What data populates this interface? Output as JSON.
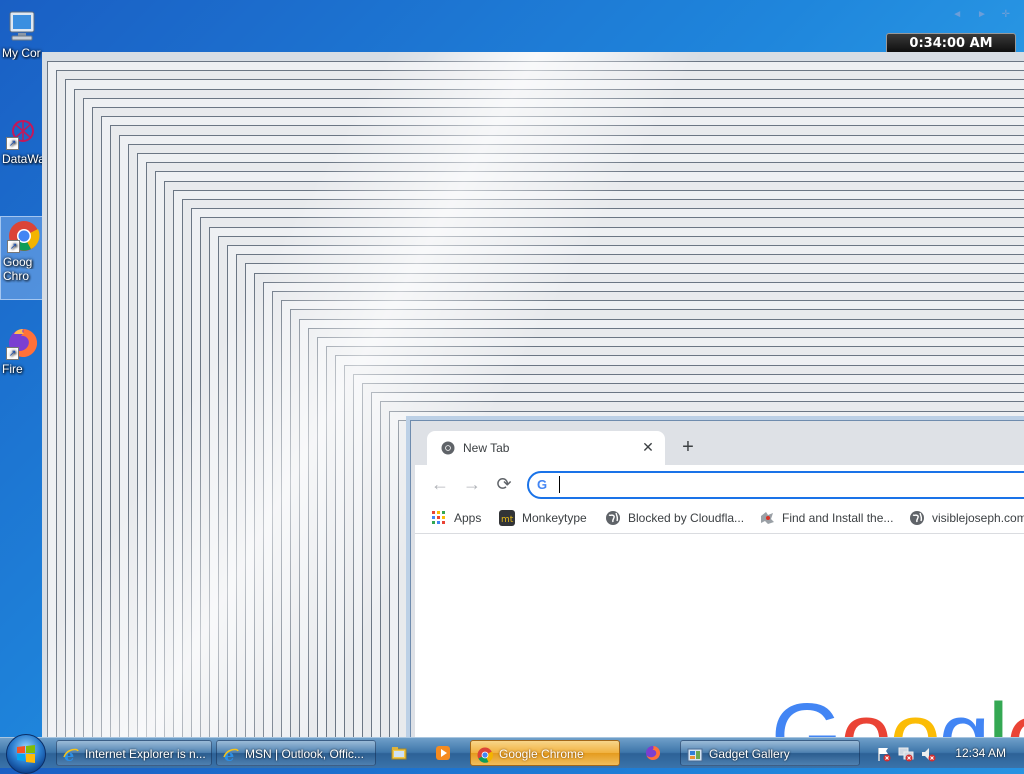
{
  "desktop": {
    "icons": [
      {
        "label": "My Cor",
        "icon": "computer-icon"
      },
      {
        "label": "DataWa",
        "icon": "datawarrior-icon"
      },
      {
        "label": "Goo\nChro",
        "label_line1": "Goog",
        "label_line2": "Chro",
        "icon": "chrome-icon"
      },
      {
        "label": "Fire",
        "icon": "firefox-icon"
      }
    ]
  },
  "gadget": {
    "clock_text": "0:34:00 AM",
    "nav_arrows": "◄ ► ✛"
  },
  "chrome": {
    "tab_title": "New Tab",
    "tab_close": "✕",
    "new_tab": "+",
    "back": "←",
    "forward": "→",
    "reload": "⟳",
    "omnibox": {
      "value": "",
      "icon": "G"
    },
    "bookmarks": [
      {
        "label": "Apps",
        "icon": "apps-grid-icon"
      },
      {
        "label": "Monkeytype",
        "icon": "monkeytype-icon"
      },
      {
        "label": "Blocked by Cloudfla...",
        "icon": "globe-icon"
      },
      {
        "label": "Find and Install the...",
        "icon": "puzzle-icon"
      },
      {
        "label": "visiblejoseph.com",
        "icon": "globe-icon"
      }
    ],
    "google_logo": "Google",
    "colors": {
      "blue": "#4285f4",
      "red": "#ea4335",
      "yellow": "#fbbc05",
      "green": "#34a853"
    }
  },
  "taskbar": {
    "buttons": [
      {
        "label": "Internet Explorer is n...",
        "icon": "ie-icon"
      },
      {
        "label": "MSN | Outlook, Offic...",
        "icon": "ie-icon"
      },
      {
        "label": "Google Chrome",
        "icon": "chrome-icon",
        "active": true
      },
      {
        "label": "Gadget Gallery",
        "icon": "gadget-icon"
      }
    ],
    "pinned": [
      "explorer-icon",
      "media-player-icon",
      "firefox-icon"
    ],
    "tray": {
      "time": "12:34 AM",
      "icons": [
        "action-center-icon",
        "network-icon",
        "volume-muted-icon"
      ]
    }
  }
}
